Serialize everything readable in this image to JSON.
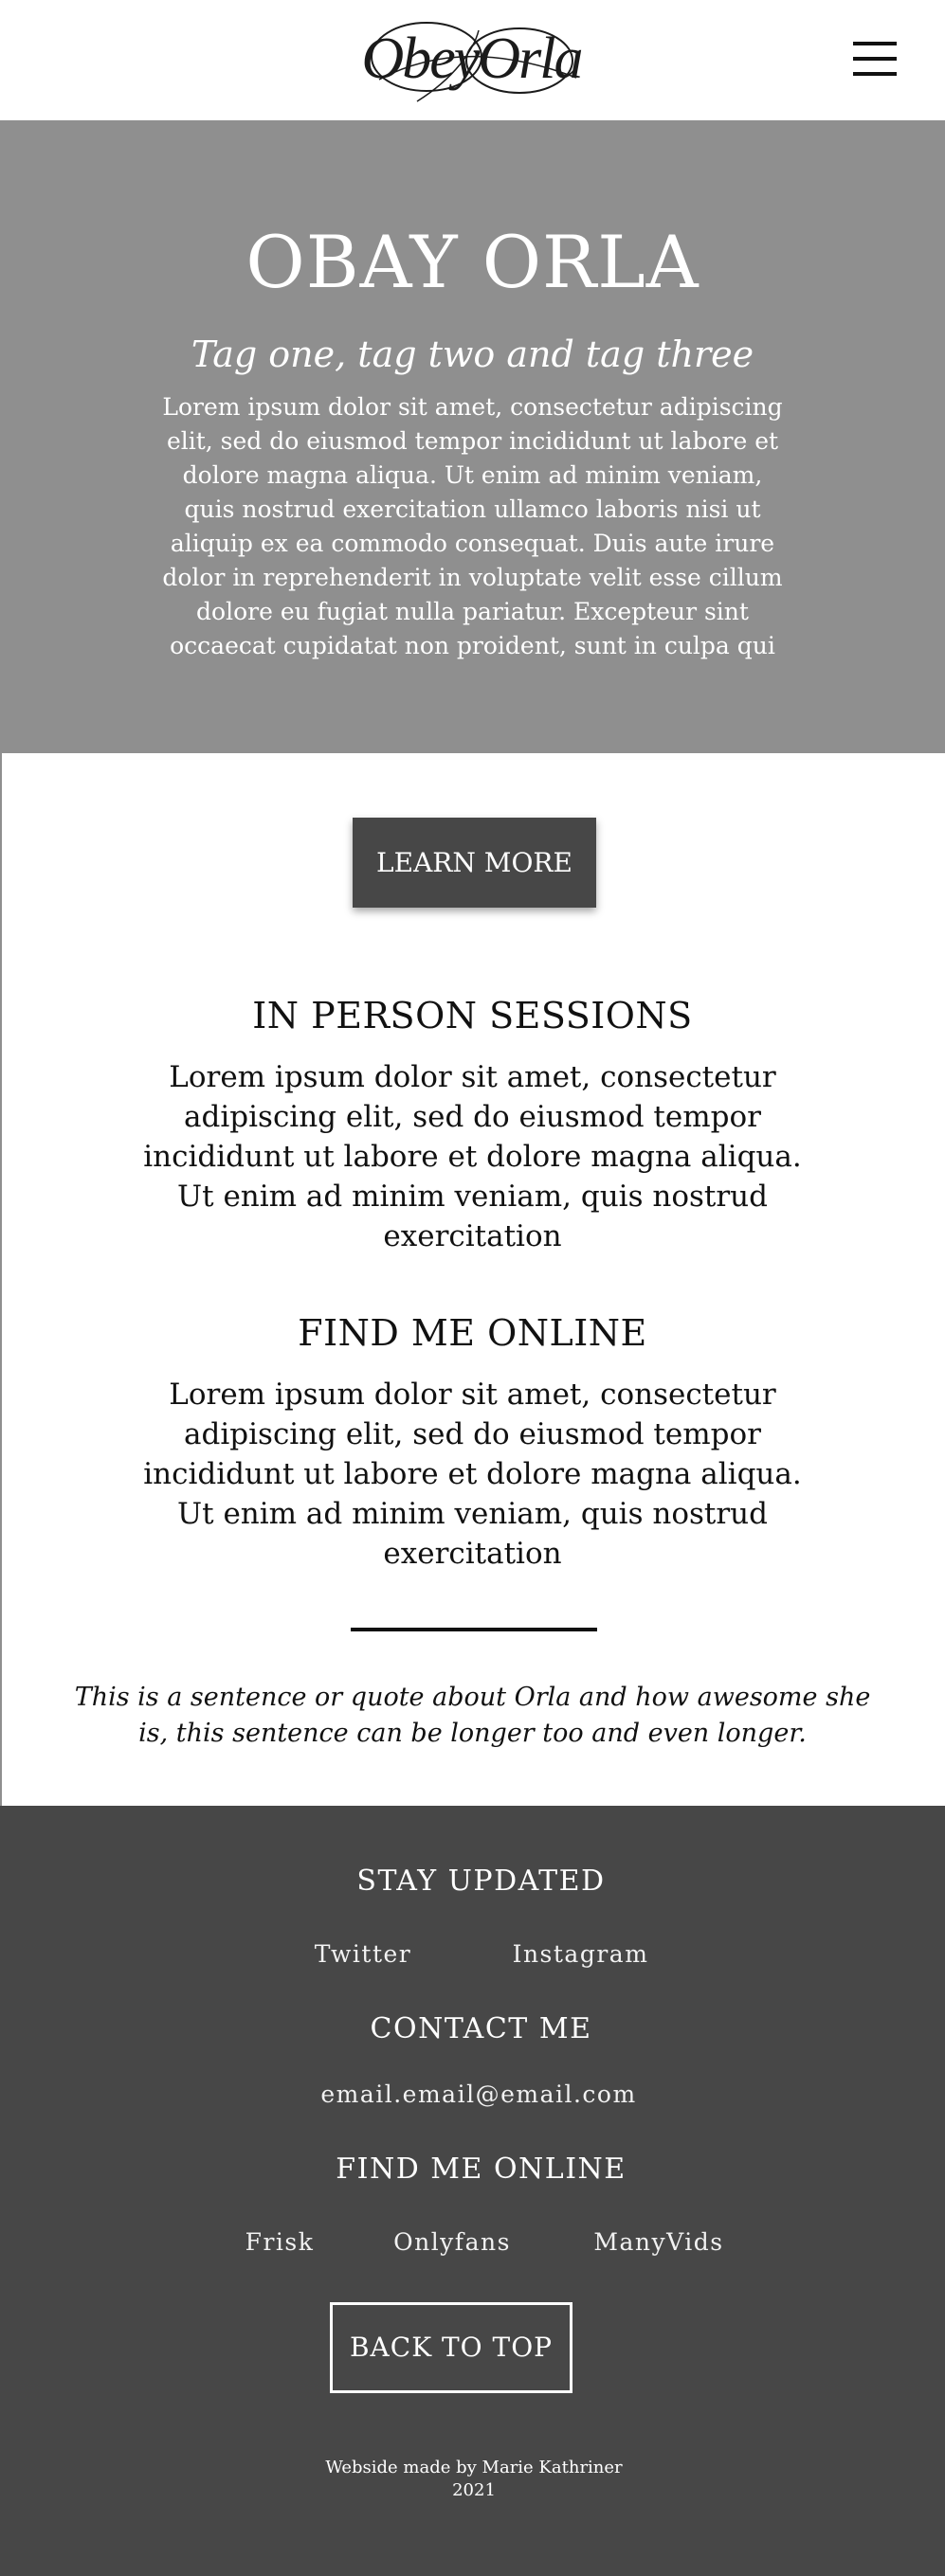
{
  "header": {
    "logo_text": "ObeyOrla",
    "menu_icon": "hamburger-menu-icon"
  },
  "hero": {
    "title": "OBAY ORLA",
    "tags": "Tag one, tag two and tag three",
    "text": "Lorem ipsum dolor sit amet, consectetur adipiscing elit, sed do eiusmod tempor incididunt ut labore et dolore magna aliqua. Ut enim ad minim veniam, quis nostrud exercitation ullamco laboris nisi ut aliquip ex ea commodo consequat. Duis aute irure dolor in reprehenderit in voluptate velit esse cillum dolore eu fugiat nulla pariatur. Excepteur sint occaecat cupidatat non proident, sunt in culpa qui"
  },
  "main": {
    "learn_more_label": "LEARN MORE",
    "sessions": {
      "title": "IN PERSON SESSIONS",
      "text": "Lorem ipsum dolor sit amet, consectetur adipiscing elit, sed do eiusmod tempor incididunt ut labore et dolore magna aliqua. Ut enim ad minim veniam, quis nostrud exercitation"
    },
    "online": {
      "title": "FIND ME ONLINE",
      "text": "Lorem ipsum dolor sit amet, consectetur adipiscing elit, sed do eiusmod tempor incididunt ut labore et dolore magna aliqua. Ut enim ad minim veniam, quis nostrud exercitation"
    },
    "quote": "This is a sentence or quote about Orla and how awesome she is, this sentence can be longer too and even longer."
  },
  "footer": {
    "stay_updated_title": "STAY UPDATED",
    "social_links": [
      "Twitter",
      "Instagram"
    ],
    "contact_title": "CONTACT ME",
    "email": "email.email@email.com",
    "online_title": "FIND ME ONLINE",
    "platform_links": [
      "Frisk",
      "Onlyfans",
      "ManyVids"
    ],
    "back_to_top_label": "BACK TO TOP",
    "credit_line": "Webside made by Marie Kathriner",
    "credit_year": "2021"
  },
  "colors": {
    "hero_bg": "#8f8f8f",
    "button_bg": "#474747",
    "footer_bg": "#474747",
    "text_dark": "#111111",
    "text_light": "#ffffff"
  }
}
